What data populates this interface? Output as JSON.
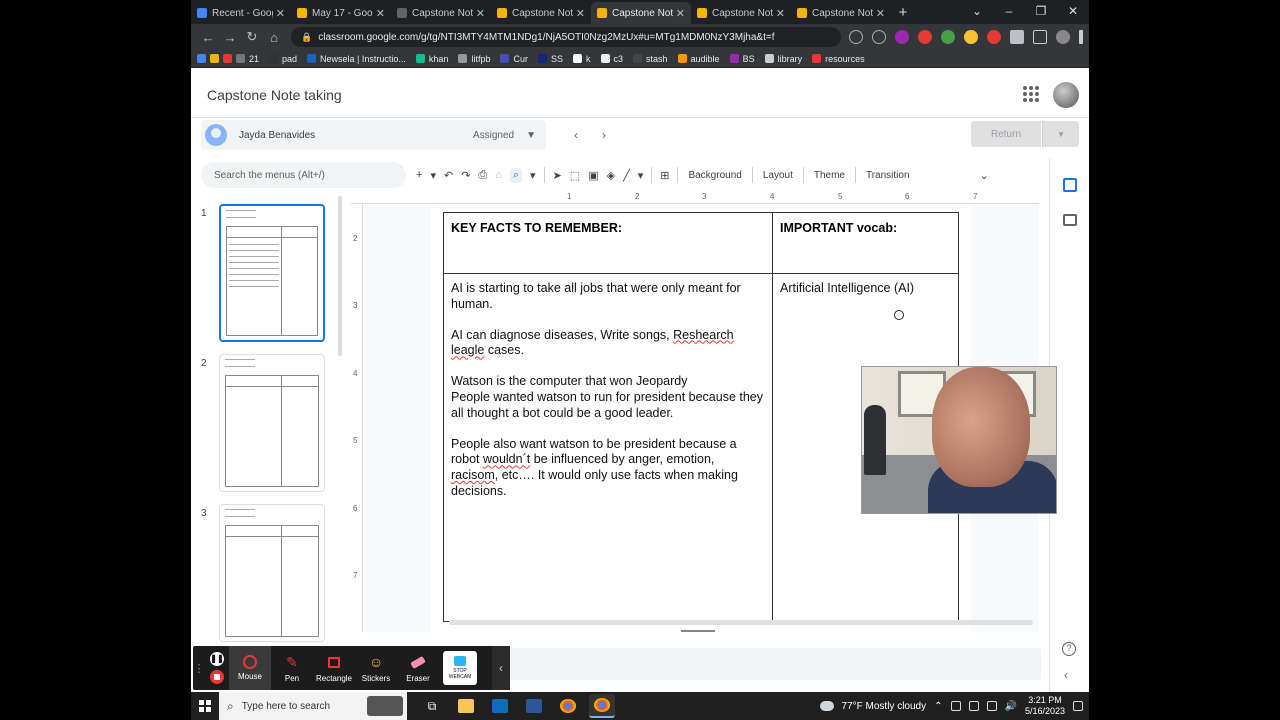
{
  "browser": {
    "tabs": [
      {
        "label": "Recent - Goog",
        "color": "#4285f4",
        "active": false
      },
      {
        "label": "May 17 - Goog",
        "color": "#f4b400",
        "active": false
      },
      {
        "label": "Capstone Note",
        "color": "#5f6368",
        "active": false
      },
      {
        "label": "Capstone Note",
        "color": "#f4b400",
        "active": false
      },
      {
        "label": "Capstone Note",
        "color": "#f4b400",
        "active": true
      },
      {
        "label": "Capstone Note",
        "color": "#f4b400",
        "active": false
      },
      {
        "label": "Capstone Note",
        "color": "#f4b400",
        "active": false
      }
    ],
    "url": "classroom.google.com/g/tg/NTI3MTY4MTM1NDg1/NjA5OTI0Nzg2MzUx#u=MTg1MDM0NzY3Mjha&t=f",
    "bookmarks": [
      "21",
      "pad",
      "Newsela | Instructio...",
      "khan",
      "litfpb",
      "Cur",
      "SS",
      "k",
      "c3",
      "stash",
      "audible",
      "BS",
      "library",
      "resources"
    ]
  },
  "classroom": {
    "title": "Capstone Note taking",
    "student_name": "Jayda Benavides",
    "status": "Assigned",
    "return_label": "Return"
  },
  "slides": {
    "menu_search_placeholder": "Search the menus (Alt+/)",
    "toolbar": {
      "background": "Background",
      "layout": "Layout",
      "theme": "Theme",
      "transition": "Transition"
    },
    "thumb_numbers": [
      "1",
      "2",
      "3"
    ],
    "ruler_h": [
      "1",
      "2",
      "3",
      "4",
      "5",
      "6",
      "7"
    ],
    "ruler_v": [
      "2",
      "3",
      "4",
      "5",
      "6",
      "7"
    ]
  },
  "slide_content": {
    "header_left": "KEY FACTS TO REMEMBER:",
    "header_right": "IMPORTANT vocab:",
    "note1": "AI is starting to take all jobs that were only meant for human.",
    "note2_a": "AI can diagnose diseases, Write songs, ",
    "note2_b": "Reshearch",
    "note2_c": "leagle",
    "note2_d": " cases.",
    "note3": "Watson is the computer that won Jeopardy",
    "note4": "People wanted watson to run for president because they all thought a bot could be a good leader.",
    "note5_a": "People also want watson to be president because a robot ",
    "note5_b": "wouldn´t",
    "note5_c": " be influenced by anger, emotion, ",
    "note5_d": "racisom",
    "note5_e": ", etc…. It would only use facts when making decisions.",
    "vocab1": "Artificial Intelligence (AI)"
  },
  "recorder": {
    "tools": [
      "Mouse",
      "Pen",
      "Rectangle",
      "Stickers",
      "Eraser"
    ],
    "webcam_label_1": "STOP",
    "webcam_label_2": "WEBCAM"
  },
  "taskbar": {
    "search_placeholder": "Type here to search",
    "weather": "77°F  Mostly cloudy",
    "time": "3:21 PM",
    "date": "5/16/2023"
  }
}
